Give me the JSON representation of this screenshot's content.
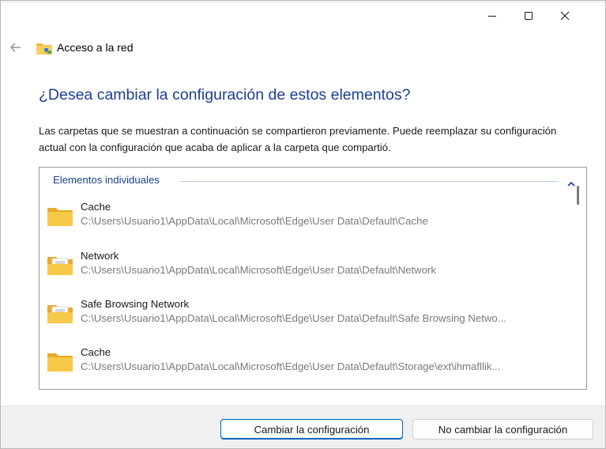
{
  "window": {
    "minimize_icon": "minimize-icon",
    "maximize_icon": "maximize-icon",
    "close_icon": "close-icon"
  },
  "nav": {
    "back_icon": "back-arrow-icon",
    "app_icon": "network-folder-icon",
    "title": "Acceso a la red"
  },
  "main": {
    "heading": "¿Desea cambiar la configuración de estos elementos?",
    "description": "Las carpetas que se muestran a continuación se compartieron previamente. Puede reemplazar su configuración actual con la configuración que acaba de aplicar a la carpeta que compartió.",
    "group": {
      "label": "Elementos individuales",
      "collapse_icon": "chevron-up-icon"
    },
    "items": [
      {
        "name": "Cache",
        "path": "C:\\Users\\Usuario1\\AppData\\Local\\Microsoft\\Edge\\User Data\\Default\\Cache",
        "icon": "folder-icon"
      },
      {
        "name": "Network",
        "path": "C:\\Users\\Usuario1\\AppData\\Local\\Microsoft\\Edge\\User Data\\Default\\Network",
        "icon": "folder-with-documents-icon"
      },
      {
        "name": "Safe Browsing Network",
        "path": "C:\\Users\\Usuario1\\AppData\\Local\\Microsoft\\Edge\\User Data\\Default\\Safe Browsing Netwo...",
        "icon": "folder-with-documents-icon"
      },
      {
        "name": "Cache",
        "path": "C:\\Users\\Usuario1\\AppData\\Local\\Microsoft\\Edge\\User Data\\Default\\Storage\\ext\\ihmafllik...",
        "icon": "folder-icon"
      }
    ]
  },
  "footer": {
    "change_label": "Cambiar la configuración",
    "no_change_label": "No cambiar la configuración"
  },
  "colors": {
    "accent": "#0067c0",
    "heading": "#1b3f91",
    "folder": "#f7c948"
  }
}
